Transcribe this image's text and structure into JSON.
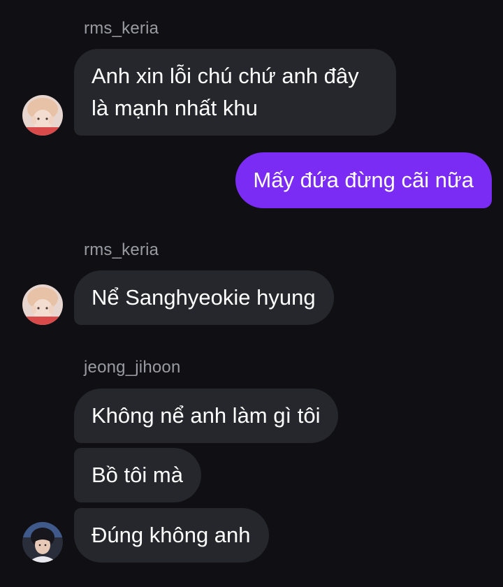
{
  "conversation": {
    "messages": [
      {
        "sender": "rms_keria",
        "text": "Anh xin lỗi chú chứ anh đây là mạnh nhất khu"
      },
      {
        "sender": "me",
        "text": "Mấy đứa đừng cãi nữa"
      },
      {
        "sender": "rms_keria",
        "text": "Nể Sanghyeokie hyung"
      },
      {
        "sender": "jeong_jihoon",
        "text": "Không nể anh làm gì tôi"
      },
      {
        "sender": "jeong_jihoon",
        "text": "Bồ tôi mà"
      },
      {
        "sender": "jeong_jihoon",
        "text": "Đúng không anh"
      }
    ],
    "sender_labels": {
      "keria_1": "rms_keria",
      "keria_2": "rms_keria",
      "jihoon": "jeong_jihoon"
    }
  },
  "colors": {
    "background": "#0f0f14",
    "incoming_bubble": "#26272c",
    "outgoing_bubble": "#7a2cf5",
    "sender_name": "#9a9aa2"
  },
  "icons": {
    "keria_avatar": "avatar-photo-blond-hair",
    "jihoon_avatar": "avatar-photo-dark-hair"
  }
}
